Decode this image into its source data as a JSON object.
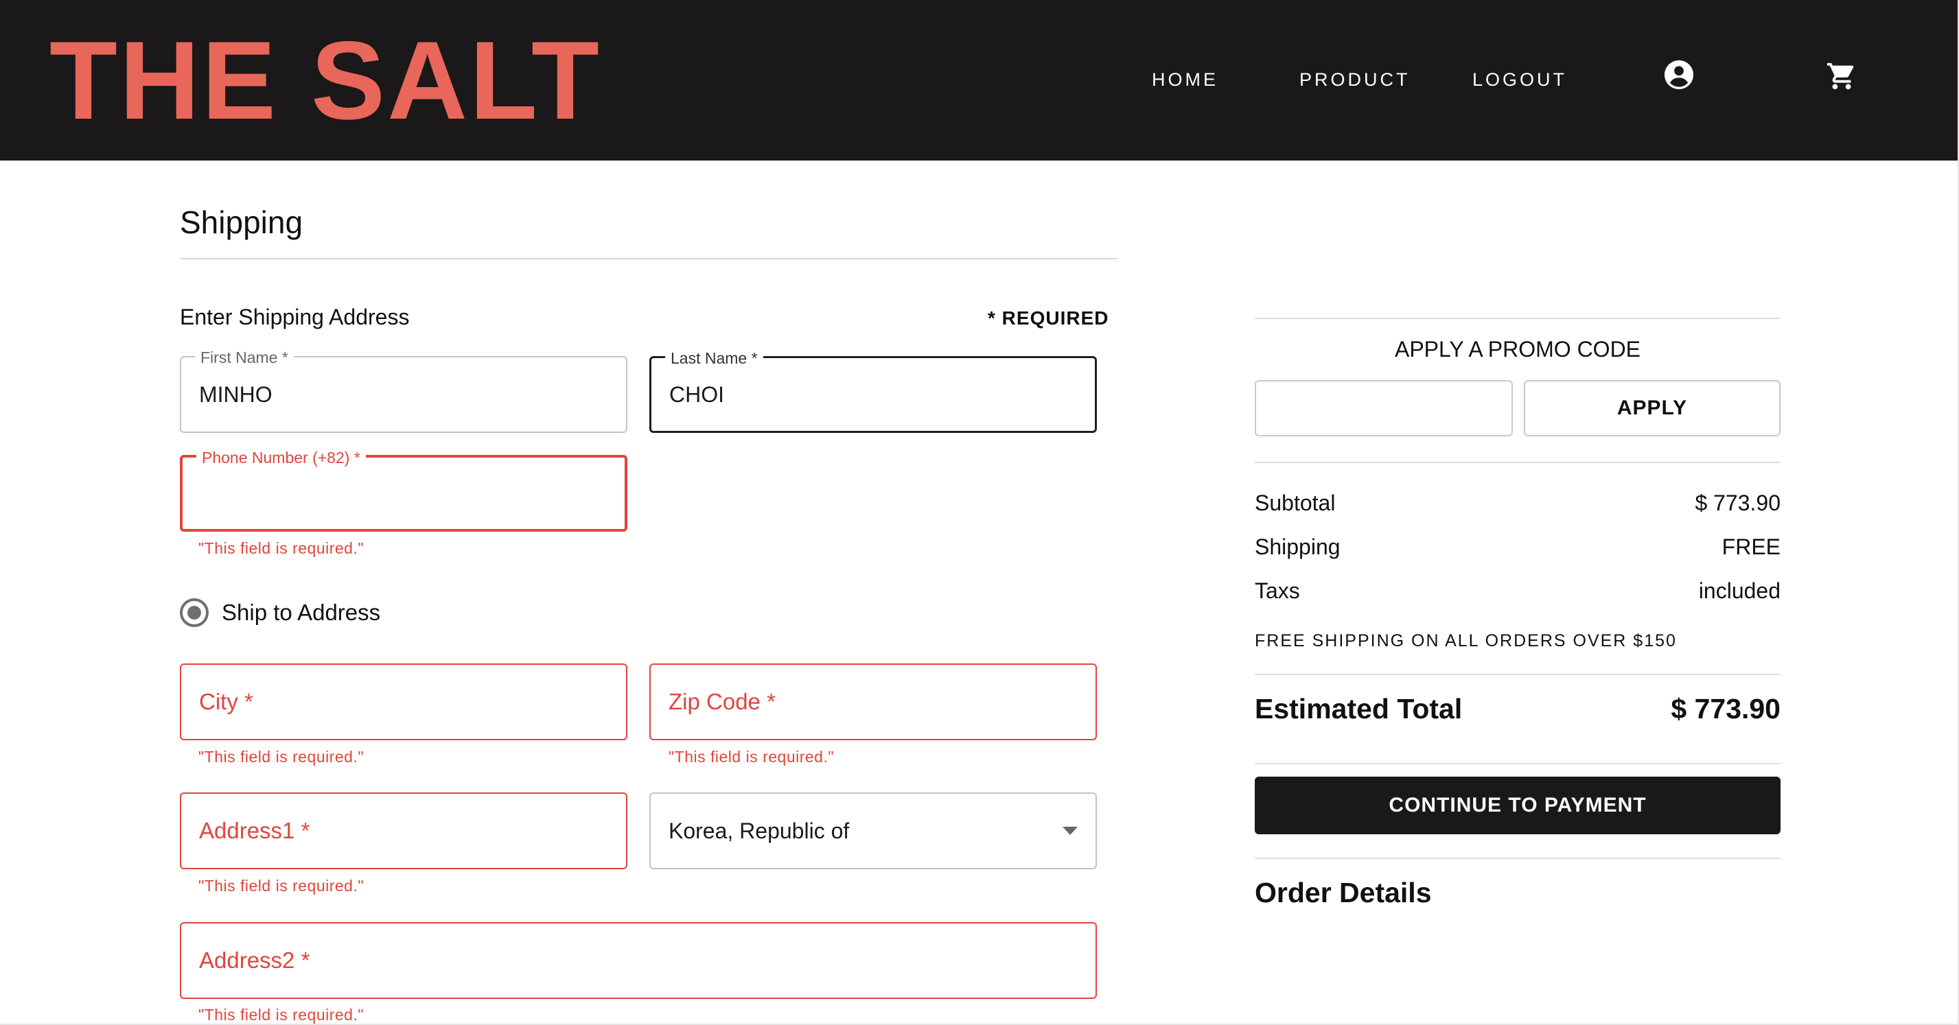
{
  "brand": {
    "logo": "THE SALT",
    "logo_color": "#e8665a",
    "header_bg": "#1a1818"
  },
  "nav": {
    "items": [
      "HOME",
      "PRODUCT",
      "LOGOUT"
    ],
    "icons": [
      "account-circle-icon",
      "cart-icon"
    ]
  },
  "shipping": {
    "title": "Shipping",
    "address_heading": "Enter Shipping Address",
    "required_note": "* REQUIRED",
    "fields": {
      "first_name": {
        "label": "First Name *",
        "value": "MINHO"
      },
      "last_name": {
        "label": "Last Name *",
        "value": "CHOI"
      },
      "phone": {
        "label": "Phone Number (+82) *",
        "value": "",
        "error": "\"This field is required.\""
      },
      "city": {
        "placeholder": "City *",
        "error": "\"This field is required.\""
      },
      "zip": {
        "placeholder": "Zip Code *",
        "error": "\"This field is required.\""
      },
      "address1": {
        "placeholder": "Address1 *",
        "error": "\"This field is required.\""
      },
      "country": {
        "value": "Korea, Republic of"
      },
      "address2": {
        "placeholder": "Address2 *",
        "error": "\"This field is required.\""
      }
    },
    "ship_option": {
      "label": "Ship to Address",
      "selected": true
    }
  },
  "summary": {
    "promo_heading": "APPLY A PROMO CODE",
    "promo_value": "",
    "apply_label": "APPLY",
    "rows": [
      {
        "label": "Subtotal",
        "value": "$ 773.90"
      },
      {
        "label": "Shipping",
        "value": "FREE"
      },
      {
        "label": "Taxs",
        "value": "included"
      }
    ],
    "free_shipping_note": "FREE SHIPPING ON ALL ORDERS OVER $150",
    "estimated_total_label": "Estimated Total",
    "estimated_total_value": "$ 773.90",
    "continue_label": "CONTINUE TO PAYMENT",
    "order_details_label": "Order Details"
  },
  "colors": {
    "error": "#e0463c",
    "button_dark": "#1a1818"
  }
}
